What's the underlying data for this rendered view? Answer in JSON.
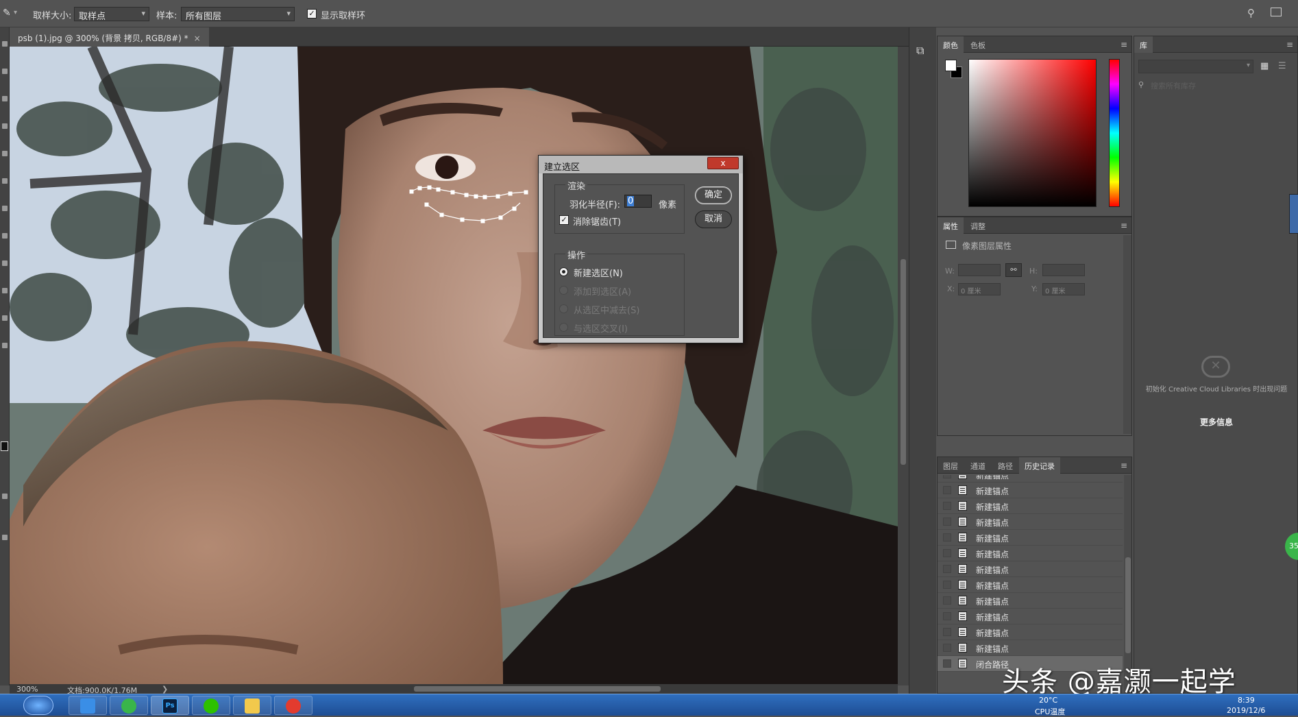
{
  "options_bar": {
    "sample_size_label": "取样大小:",
    "sample_size_value": "取样点",
    "sample_label": "样本:",
    "sample_value": "所有图层",
    "show_ring_label": "显示取样环",
    "show_ring_checked": true
  },
  "document": {
    "tab_title": "psb (1).jpg @ 300% (背景 拷贝, RGB/8#) *",
    "close_glyph": "×",
    "zoom": "300%",
    "doc_info": "文档:900.0K/1.76M",
    "status_arrow": "❯"
  },
  "color_panel": {
    "tabs": [
      "颜色",
      "色板"
    ],
    "accent_red": "#ff0000"
  },
  "properties_panel": {
    "tabs": [
      "属性",
      "调整"
    ],
    "subtitle": "像素图层属性",
    "w_label": "W:",
    "h_label": "H:",
    "x_label": "X:",
    "y_label": "Y:",
    "x_value": "0 厘米",
    "y_value": "0 厘米"
  },
  "library_panel": {
    "tab": "库",
    "search_placeholder": "搜索所有库存",
    "message": "初始化 Creative Cloud Libraries 时出现问题",
    "more_info": "更多信息"
  },
  "history_panel": {
    "tabs": [
      "图层",
      "通道",
      "路径",
      "历史记录"
    ],
    "items": [
      "新建锚点",
      "新建锚点",
      "新建锚点",
      "新建锚点",
      "新建锚点",
      "新建锚点",
      "新建锚点",
      "新建锚点",
      "新建锚点",
      "新建锚点",
      "新建锚点",
      "新建锚点",
      "闭合路径"
    ]
  },
  "dialog": {
    "title": "建立选区",
    "close_glyph": "x",
    "render_group": "渲染",
    "feather_label": "羽化半径(F):",
    "feather_value": "0",
    "feather_unit": "像素",
    "antialias_label": "消除锯齿(T)",
    "antialias_checked": true,
    "operation_group": "操作",
    "ops": [
      "新建选区(N)",
      "添加到选区(A)",
      "从选区中减去(S)",
      "与选区交叉(I)"
    ],
    "ok": "确定",
    "cancel": "取消"
  },
  "taskbar": {
    "temp": "20°C",
    "temp_label": "CPU温度",
    "time": "8:39",
    "date": "2019/12/6",
    "badge": "35"
  },
  "watermark": "头条 @嘉灏一起学"
}
